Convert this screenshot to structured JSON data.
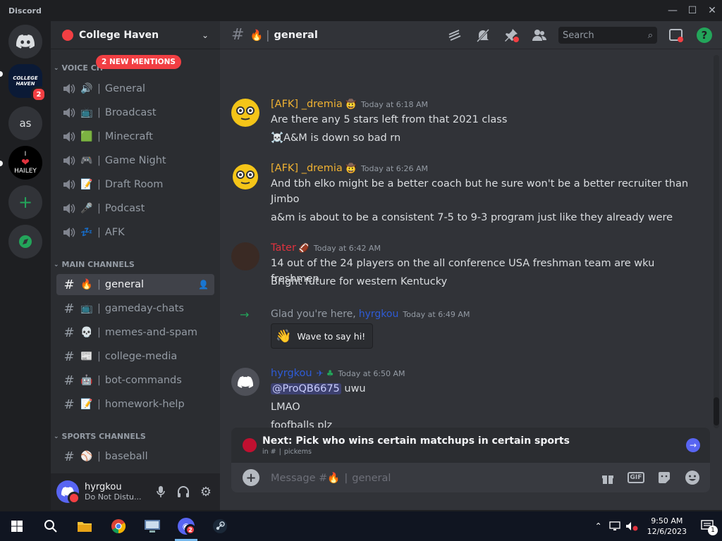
{
  "window": {
    "title": "Discord",
    "controls": [
      "minimize",
      "maximize",
      "close"
    ]
  },
  "rail": {
    "servers": [
      {
        "name": "home",
        "icon": "discord-logo-icon"
      },
      {
        "name": "College Haven",
        "label": "COLLEGE HAVEN",
        "badge": "2"
      },
      {
        "name": "as",
        "label": "as"
      },
      {
        "name": "hailey",
        "label_top": "I",
        "label_bottom": "HAILEY"
      },
      {
        "name": "add-server",
        "icon": "plus-icon"
      },
      {
        "name": "discover",
        "icon": "compass-icon"
      }
    ]
  },
  "sidebar": {
    "server_name": "College Haven",
    "mentions_pill": "2 NEW MENTIONS",
    "categories": {
      "voice": "VOICE CH",
      "main": "MAIN CHANNELS",
      "sports": "SPORTS CHANNELS"
    },
    "voice_channels": [
      {
        "emoji": "🔊",
        "name": "General"
      },
      {
        "emoji": "📺",
        "name": "Broadcast"
      },
      {
        "emoji": "🟩",
        "name": "Minecraft"
      },
      {
        "emoji": "🎮",
        "name": "Game Night"
      },
      {
        "emoji": "📝",
        "name": "Draft Room"
      },
      {
        "emoji": "🎤",
        "name": "Podcast"
      },
      {
        "emoji": "💤",
        "name": "AFK"
      }
    ],
    "main_channels": [
      {
        "emoji": "🔥",
        "name": "general",
        "active": true
      },
      {
        "emoji": "📺",
        "name": "gameday-chats"
      },
      {
        "emoji": "💀",
        "name": "memes-and-spam"
      },
      {
        "emoji": "📰",
        "name": "college-media"
      },
      {
        "emoji": "🤖",
        "name": "bot-commands"
      },
      {
        "emoji": "📝",
        "name": "homework-help"
      }
    ],
    "sports_channels": [
      {
        "emoji": "⚾",
        "name": "baseball"
      }
    ]
  },
  "user": {
    "name": "hyrgkou",
    "status": "Do Not Distu..."
  },
  "header": {
    "channel": "general",
    "emoji": "🔥",
    "search_placeholder": "Search"
  },
  "messages": [
    {
      "author": "[AFK] _dremia",
      "badge": "🤠",
      "time": "Today at 6:18 AM",
      "color": "#f0b232",
      "lines": [
        "Are there any 5 stars left from that 2021 class",
        "☠️A&M is down so bad rn"
      ]
    },
    {
      "author": "[AFK] _dremia",
      "badge": "🤠",
      "time": "Today at 6:26 AM",
      "color": "#f0b232",
      "lines": [
        "And tbh elko might be a better coach but he sure won't be a better recruiter than Jimbo",
        "a&m is about to be a consistent 7-5 to 9-3 program just like they already were"
      ]
    },
    {
      "author": "Tater",
      "badge": "🏈",
      "time": "Today at 6:42 AM",
      "color": "#e0333e",
      "lines": [
        "14 out of the 24 players on the all conference USA freshman team are wku freshmen",
        "Bright future for western Kentucky"
      ]
    },
    {
      "system_text": "Glad you're here,",
      "system_user": "hyrgkou",
      "time": "Today at 6:49 AM",
      "wave_label": "Wave to say hi!"
    },
    {
      "author": "hyrgkou",
      "time": "Today at 6:50 AM",
      "color": "#2e5bd6",
      "mention": "@ProQB6675",
      "mention_rest": " uwu",
      "lines": [
        "LMAO",
        "foofballs plz"
      ]
    }
  ],
  "next_bar": {
    "title": "Next: Pick who wins certain matchups in certain sports",
    "sub_prefix": "in #",
    "sub_channel": "pickems"
  },
  "composer": {
    "placeholder_prefix": "Message #",
    "placeholder_channel": "general"
  },
  "taskbar": {
    "time": "9:50 AM",
    "date": "12/6/2023",
    "notifications": "1"
  }
}
